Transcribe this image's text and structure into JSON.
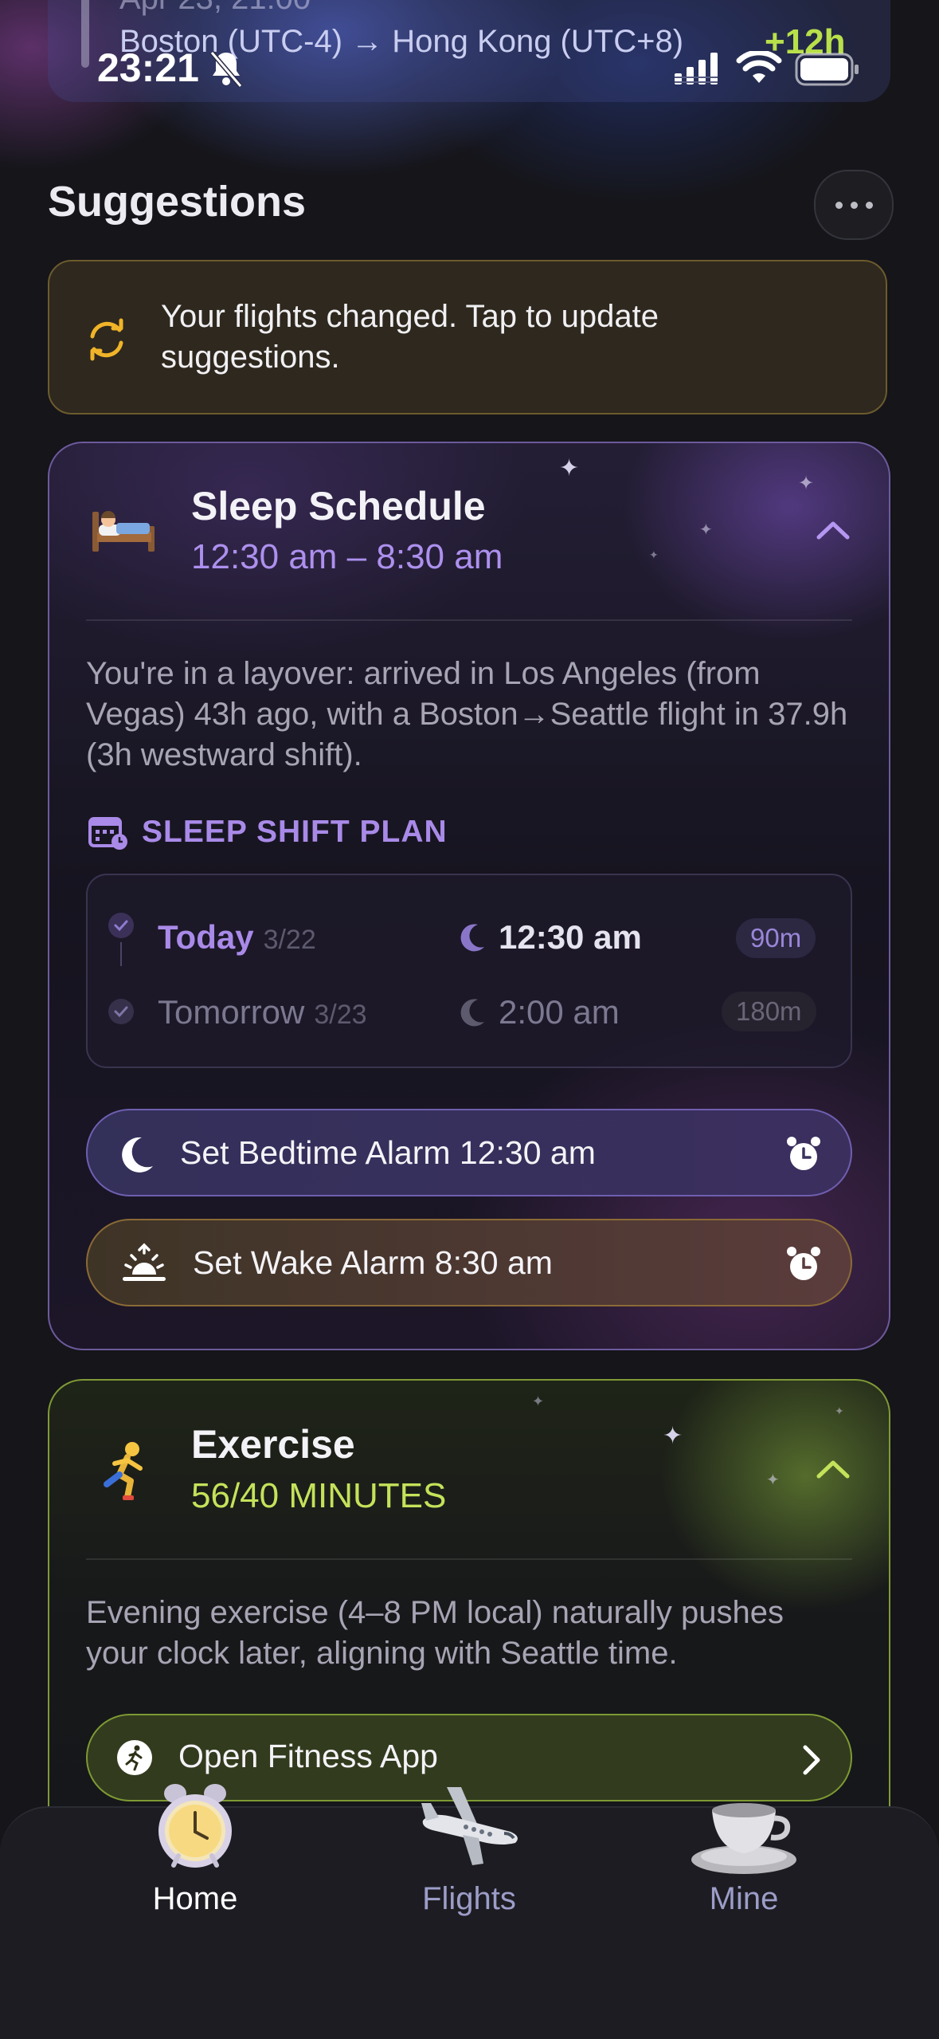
{
  "status_bar": {
    "time": "23:21"
  },
  "top_card": {
    "date": "Apr 23, 21:00",
    "route": "Boston (UTC-4) → Hong Kong (UTC+8)",
    "time_diff": "+12h"
  },
  "suggestions": {
    "title": "Suggestions",
    "banner_text": "Your flights changed. Tap to update suggestions."
  },
  "sleep": {
    "title": "Sleep Schedule",
    "time_range": "12:30 am – 8:30 am",
    "description": "You're in a layover: arrived in Los Angeles (from Vegas) 43h ago, with a Boston→Seattle flight in 37.9h (3h westward shift).",
    "plan_label": "SLEEP SHIFT PLAN",
    "plan": [
      {
        "day": "Today",
        "date": "3/22",
        "bedtime": "12:30 am",
        "minutes": "90m"
      },
      {
        "day": "Tomorrow",
        "date": "3/23",
        "bedtime": "2:00 am",
        "minutes": "180m"
      }
    ],
    "bedtime_alarm": "Set Bedtime Alarm  12:30 am",
    "wake_alarm": "Set Wake Alarm  8:30 am"
  },
  "exercise": {
    "title": "Exercise",
    "progress": "56/40 MINUTES",
    "description": "Evening exercise (4–8 PM local) naturally pushes your clock later, aligning with Seattle time.",
    "button": "Open Fitness App"
  },
  "tabs": [
    {
      "label": "Home",
      "active": true,
      "icon": "alarm-clock-icon"
    },
    {
      "label": "Flights",
      "active": false,
      "icon": "airplane-icon"
    },
    {
      "label": "Mine",
      "active": false,
      "icon": "teacup-icon"
    }
  ],
  "colors": {
    "sleep_accent": "#ad90ee",
    "exercise_accent": "#c4e25a",
    "banner_bg": "#2e281e"
  }
}
